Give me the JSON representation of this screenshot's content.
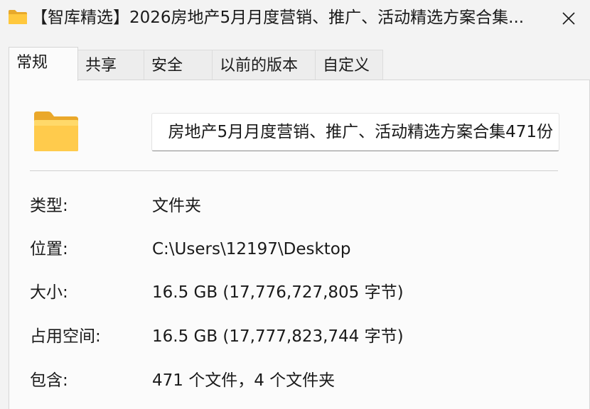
{
  "window": {
    "title": "【智库精选】2026房地产5月月度营销、推广、活动精选方案合集...",
    "title_icon": "folder-icon",
    "close_icon": "close-icon"
  },
  "tabs": [
    {
      "label": "常规",
      "active": true
    },
    {
      "label": "共享",
      "active": false
    },
    {
      "label": "安全",
      "active": false
    },
    {
      "label": "以前的版本",
      "active": false
    },
    {
      "label": "自定义",
      "active": false
    }
  ],
  "general": {
    "folder_icon": "folder-icon",
    "name_value": "房地产5月月度营销、推广、活动精选方案合集471份",
    "rows": [
      {
        "label": "类型:",
        "value": "文件夹"
      },
      {
        "label": "位置:",
        "value": "C:\\Users\\12197\\Desktop"
      },
      {
        "label": "大小:",
        "value": "16.5 GB (17,776,727,805 字节)"
      },
      {
        "label": "占用空间:",
        "value": "16.5 GB (17,777,823,744 字节)"
      },
      {
        "label": "包含:",
        "value": "471 个文件，4 个文件夹"
      }
    ]
  },
  "colors": {
    "folder_yellow": "#ffc83d",
    "folder_light": "#ffd96a",
    "background": "#f3f3f3",
    "panel": "#fbfbfb"
  }
}
